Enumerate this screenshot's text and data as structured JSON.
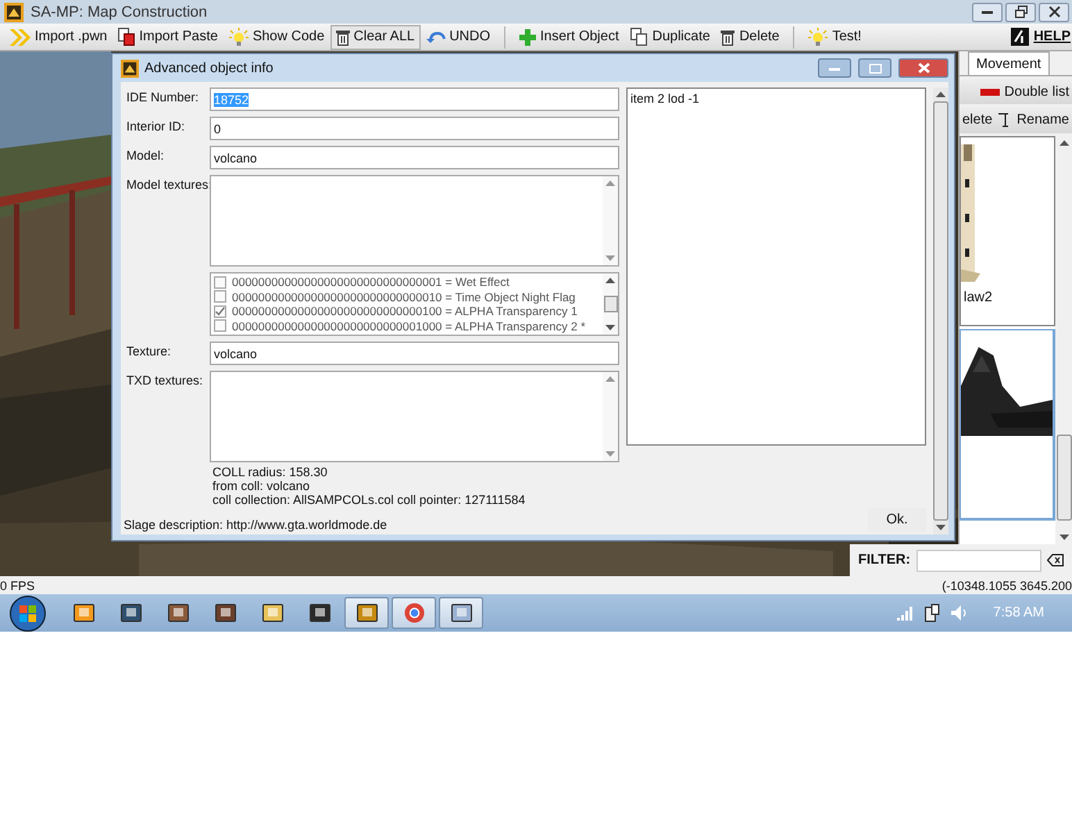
{
  "window": {
    "title": "SA-MP: Map Construction"
  },
  "toolbar": {
    "groups": [
      {
        "items": [
          {
            "label": "Import .pwn",
            "pressed": false
          },
          {
            "label": "Import Paste",
            "pressed": false
          },
          {
            "label": "Show Code",
            "pressed": false
          },
          {
            "label": "Clear ALL",
            "pressed": true
          },
          {
            "label": "UNDO",
            "pressed": false
          }
        ]
      },
      {
        "items": [
          {
            "label": "Insert Object",
            "pressed": false
          },
          {
            "label": "Duplicate",
            "pressed": false
          },
          {
            "label": "Delete",
            "pressed": false
          }
        ]
      },
      {
        "items": [
          {
            "label": "Test!",
            "pressed": false
          }
        ]
      }
    ],
    "help": "HELP"
  },
  "side_panel": {
    "tabs": [
      {
        "label": "Movement",
        "selected": true
      }
    ],
    "double_list_button": "Double list",
    "buttons": [
      "elete",
      "Rename"
    ],
    "models": [
      {
        "label": "law2",
        "selected": false
      },
      {
        "selected": true
      }
    ],
    "filter": {
      "label": "FILTER:"
    }
  },
  "dialog": {
    "title": "Advanced object info",
    "rows": [
      {
        "kind": "text",
        "label": "IDE Number:",
        "value": "18752",
        "value_selected": true
      },
      {
        "kind": "text",
        "label": "Interior ID:",
        "value": "0",
        "value_selected": false
      },
      {
        "kind": "text",
        "label": "Model:",
        "value": "volcano",
        "value_selected": false
      },
      {
        "kind": "textarea",
        "label": "Model textures:"
      },
      {
        "kind": "flags",
        "flags": [
          {
            "label": "00000000000000000000000000000001 = Wet Effect",
            "checked": false
          },
          {
            "label": "00000000000000000000000000000010 = Time Object Night Flag",
            "checked": false
          },
          {
            "label": "00000000000000000000000000000100 = ALPHA Transparency 1",
            "checked": true
          },
          {
            "label": "00000000000000000000000000001000 = ALPHA Transparency 2 *",
            "checked": false
          }
        ]
      },
      {
        "kind": "text",
        "label": "Texture:",
        "value": "volcano",
        "value_selected": false
      },
      {
        "kind": "textarea",
        "label": "TXD textures:"
      }
    ],
    "coll_info": [
      "COLL radius: 158.30",
      "from coll: volcano",
      "coll collection: AllSAMPCOLs.col coll pointer: 127111584"
    ],
    "lod_list": [
      "item 2 lod -1"
    ],
    "description": "Slage description: http://www.gta.worldmode.de",
    "ok_button": "Ok."
  },
  "status_bar": {
    "fps": "0 FPS",
    "coordinates": "(-10348.1055 3645.200"
  },
  "taskbar": {
    "apps": [
      {
        "active": false
      },
      {
        "active": false
      },
      {
        "active": false
      },
      {
        "active": false
      },
      {
        "active": false
      },
      {
        "active": false
      },
      {
        "active": true
      },
      {
        "active": true
      },
      {
        "active": true
      }
    ],
    "clock": "7:58 AM"
  }
}
